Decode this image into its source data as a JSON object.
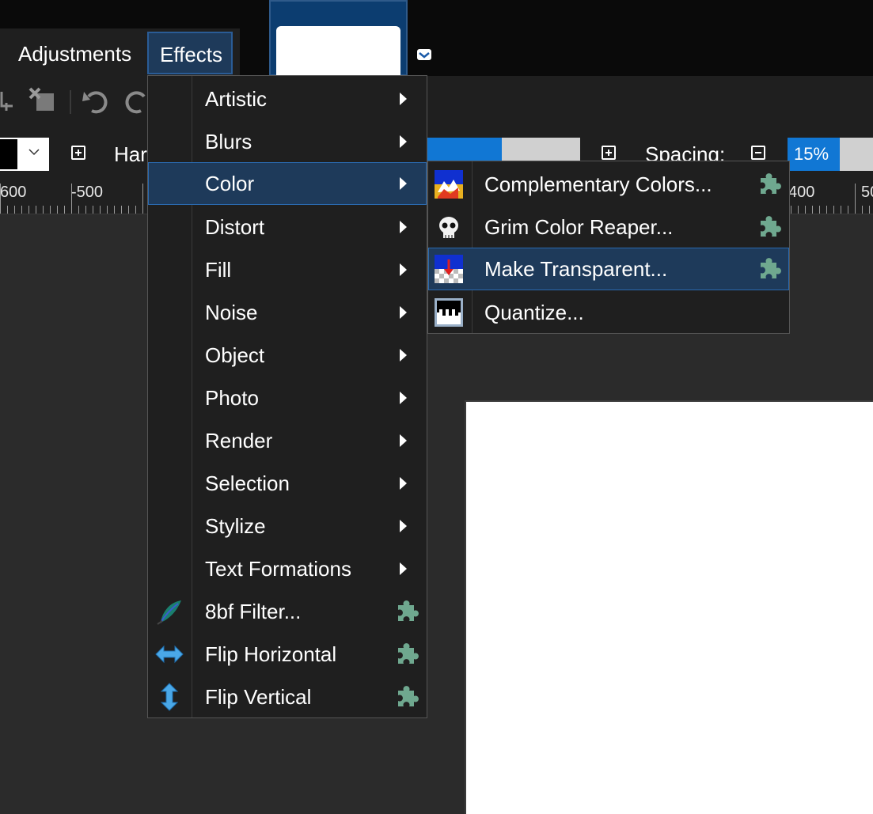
{
  "menubar": {
    "adjustments": "Adjustments",
    "effects": "Effects"
  },
  "toolbar": {
    "hardness_label": "Har",
    "spacing_label": "Spacing:",
    "spacing_value": "15%",
    "hardness_fill_fraction": 0.49,
    "spacing_fill_fraction": 0.15
  },
  "ruler": {
    "labels": [
      "600",
      "-500",
      "400",
      "50"
    ]
  },
  "effects_menu": {
    "items": [
      {
        "label": "Artistic",
        "submenu": true
      },
      {
        "label": "Blurs",
        "submenu": true
      },
      {
        "label": "Color",
        "submenu": true,
        "selected": true
      },
      {
        "label": "Distort",
        "submenu": true
      },
      {
        "label": "Fill",
        "submenu": true
      },
      {
        "label": "Noise",
        "submenu": true
      },
      {
        "label": "Object",
        "submenu": true
      },
      {
        "label": "Photo",
        "submenu": true
      },
      {
        "label": "Render",
        "submenu": true
      },
      {
        "label": "Selection",
        "submenu": true
      },
      {
        "label": "Stylize",
        "submenu": true
      },
      {
        "label": "Text Formations",
        "submenu": true
      },
      {
        "label": "8bf Filter...",
        "icon": "feather-icon",
        "plugin": true
      },
      {
        "label": "Flip Horizontal",
        "icon": "horizontal-arrows-icon",
        "plugin": true
      },
      {
        "label": "Flip Vertical",
        "icon": "vertical-arrows-icon",
        "plugin": true
      }
    ]
  },
  "color_submenu": {
    "items": [
      {
        "label": "Complementary Colors...",
        "icon": "complementary-colors-icon",
        "plugin": true
      },
      {
        "label": "Grim Color Reaper...",
        "icon": "skull-icon",
        "plugin": true
      },
      {
        "label": "Make Transparent...",
        "icon": "make-transparent-icon",
        "plugin": true,
        "selected": true
      },
      {
        "label": "Quantize...",
        "icon": "quantize-icon",
        "plugin": false
      }
    ]
  },
  "colors": {
    "accent": "#1177d4",
    "selection": "#1e3a5a",
    "plugin": "#6fa88f",
    "menu_bg": "#1f1f1f"
  }
}
